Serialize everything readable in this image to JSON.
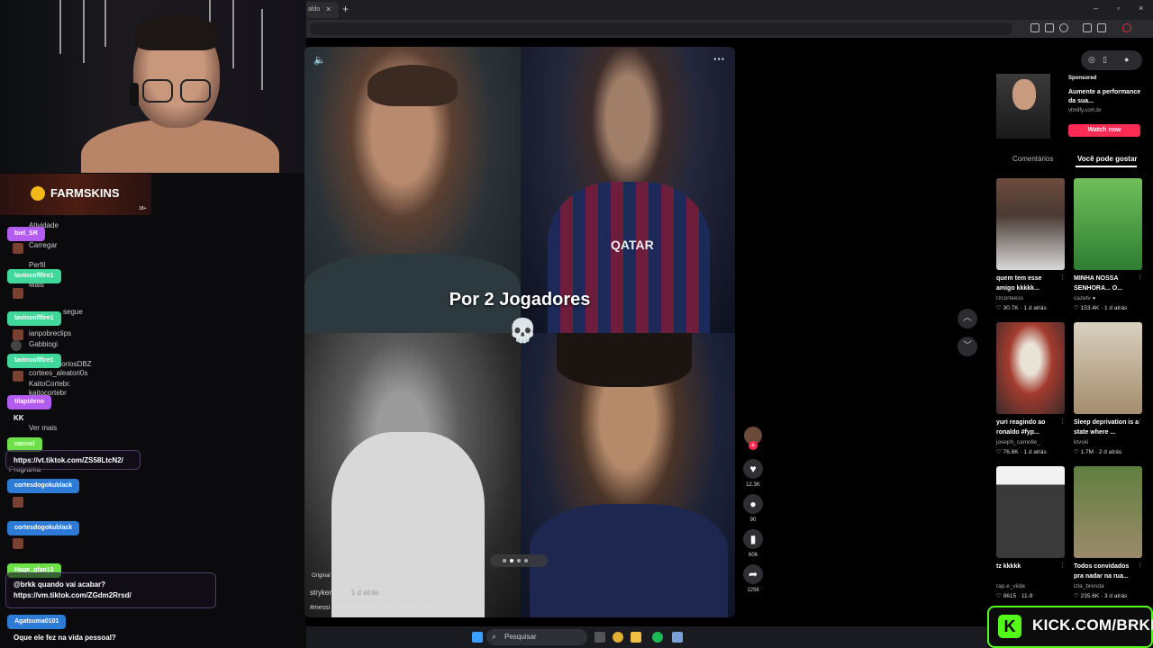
{
  "browser": {
    "tab_title": "aldo",
    "tab_close": "×",
    "new_tab": "+",
    "window_controls": [
      "–",
      "▫",
      "×"
    ]
  },
  "video": {
    "title": "Por 2 Jogadores",
    "skull": "💀",
    "audio_badge": "Original - Parnaíba",
    "author": "stryker7797",
    "date": "1 d atrás",
    "hashtags": "#messi #cristianoronaldo #goat #futebol #fy",
    "mute_icon": "🔈",
    "more_icon": "···",
    "actions": {
      "likes": "12.3K",
      "comments": "90",
      "saves": "606",
      "shares": "1256"
    }
  },
  "nav": {
    "up": "︿",
    "down": "﹀"
  },
  "ad": {
    "label": "Sponsored",
    "text": "Aumente a performance da sua...",
    "domain": "vtmilfy.com.br",
    "button": "Watch now"
  },
  "right_tabs": {
    "comments": "Comentários",
    "suggested": "Você pode gostar"
  },
  "cards": [
    {
      "caption": "quem tem esse amigo kkkkk...",
      "user": "rzcorteess",
      "stats": "♡ 30.7K · 1 d atrás",
      "color_a": "#6d4c3d",
      "color_b": "#d9d9d9"
    },
    {
      "caption": "MINHA NOSSA SENHORA... O...",
      "user": "cazetv ●",
      "stats": "♡ 153.4K · 1 d atrás",
      "color_a": "#2e7d32",
      "color_b": "#6fbf5a"
    },
    {
      "caption": "yuri reagindo ao ronaldo #fyp...",
      "user": "joseph_camolle_",
      "stats": "♡ 76.8K · 1 d atrás",
      "color_a": "#a33b2e",
      "color_b": "#e9e2d6"
    },
    {
      "caption": "Sleep deprivation is a state where ...",
      "user": "ktvski",
      "stats": "♡ 1.7M · 2 d atrás",
      "color_a": "#d9d0bf",
      "color_b": "#a48d6d"
    },
    {
      "caption": "tz kkkkk",
      "user": "rap.e_viida",
      "stats": "♡ 9615 · 11-9",
      "color_a": "#f2f2f2",
      "color_b": "#3a3a3a"
    },
    {
      "caption": "Todos convidados pra nadar na rua...",
      "user": "lzla_brenda",
      "stats": "♡ 235.6K · 3 d atrás",
      "color_a": "#5f7f3f",
      "color_b": "#9b8a6a"
    }
  ],
  "sponsor": {
    "name": "FARMSKINS",
    "age": "18+"
  },
  "chat_background": [
    "Atividade",
    "Carregar",
    "Perfil",
    "Mais",
    "segue",
    "ianpobreclips",
    "Gabbiogi",
    "ctoriosDBZ",
    "cortees_aleatori0s",
    "KaitoCortebr.",
    "kaitocortebr",
    "Ver mais",
    "Programa"
  ],
  "chat": {
    "u1": "biel_SR",
    "u2": "lavinooflfire1",
    "u3": "lavinooflfire1",
    "u4": "lavinooflfire1",
    "u5": "tilapideno",
    "kk": "KK",
    "u6": "naooel",
    "m6": "https://vt.tiktok.com/ZS58LtcN2/",
    "u7": "cortesdogokublack",
    "u8": "cortesdogokublack",
    "u9": "Hage_gfan13",
    "m9a": "@brkk quando vai acabar?",
    "m9b": "https://vm.tiktok.com/ZGdm2Rrsd/",
    "u10": "Agatsuma0101",
    "m10": "Oque ele fez na vida pessoal?"
  },
  "kick": {
    "logo": "K",
    "text": "KICK.COM/BRKK"
  },
  "taskbar": {
    "search": "Pesquisar"
  }
}
